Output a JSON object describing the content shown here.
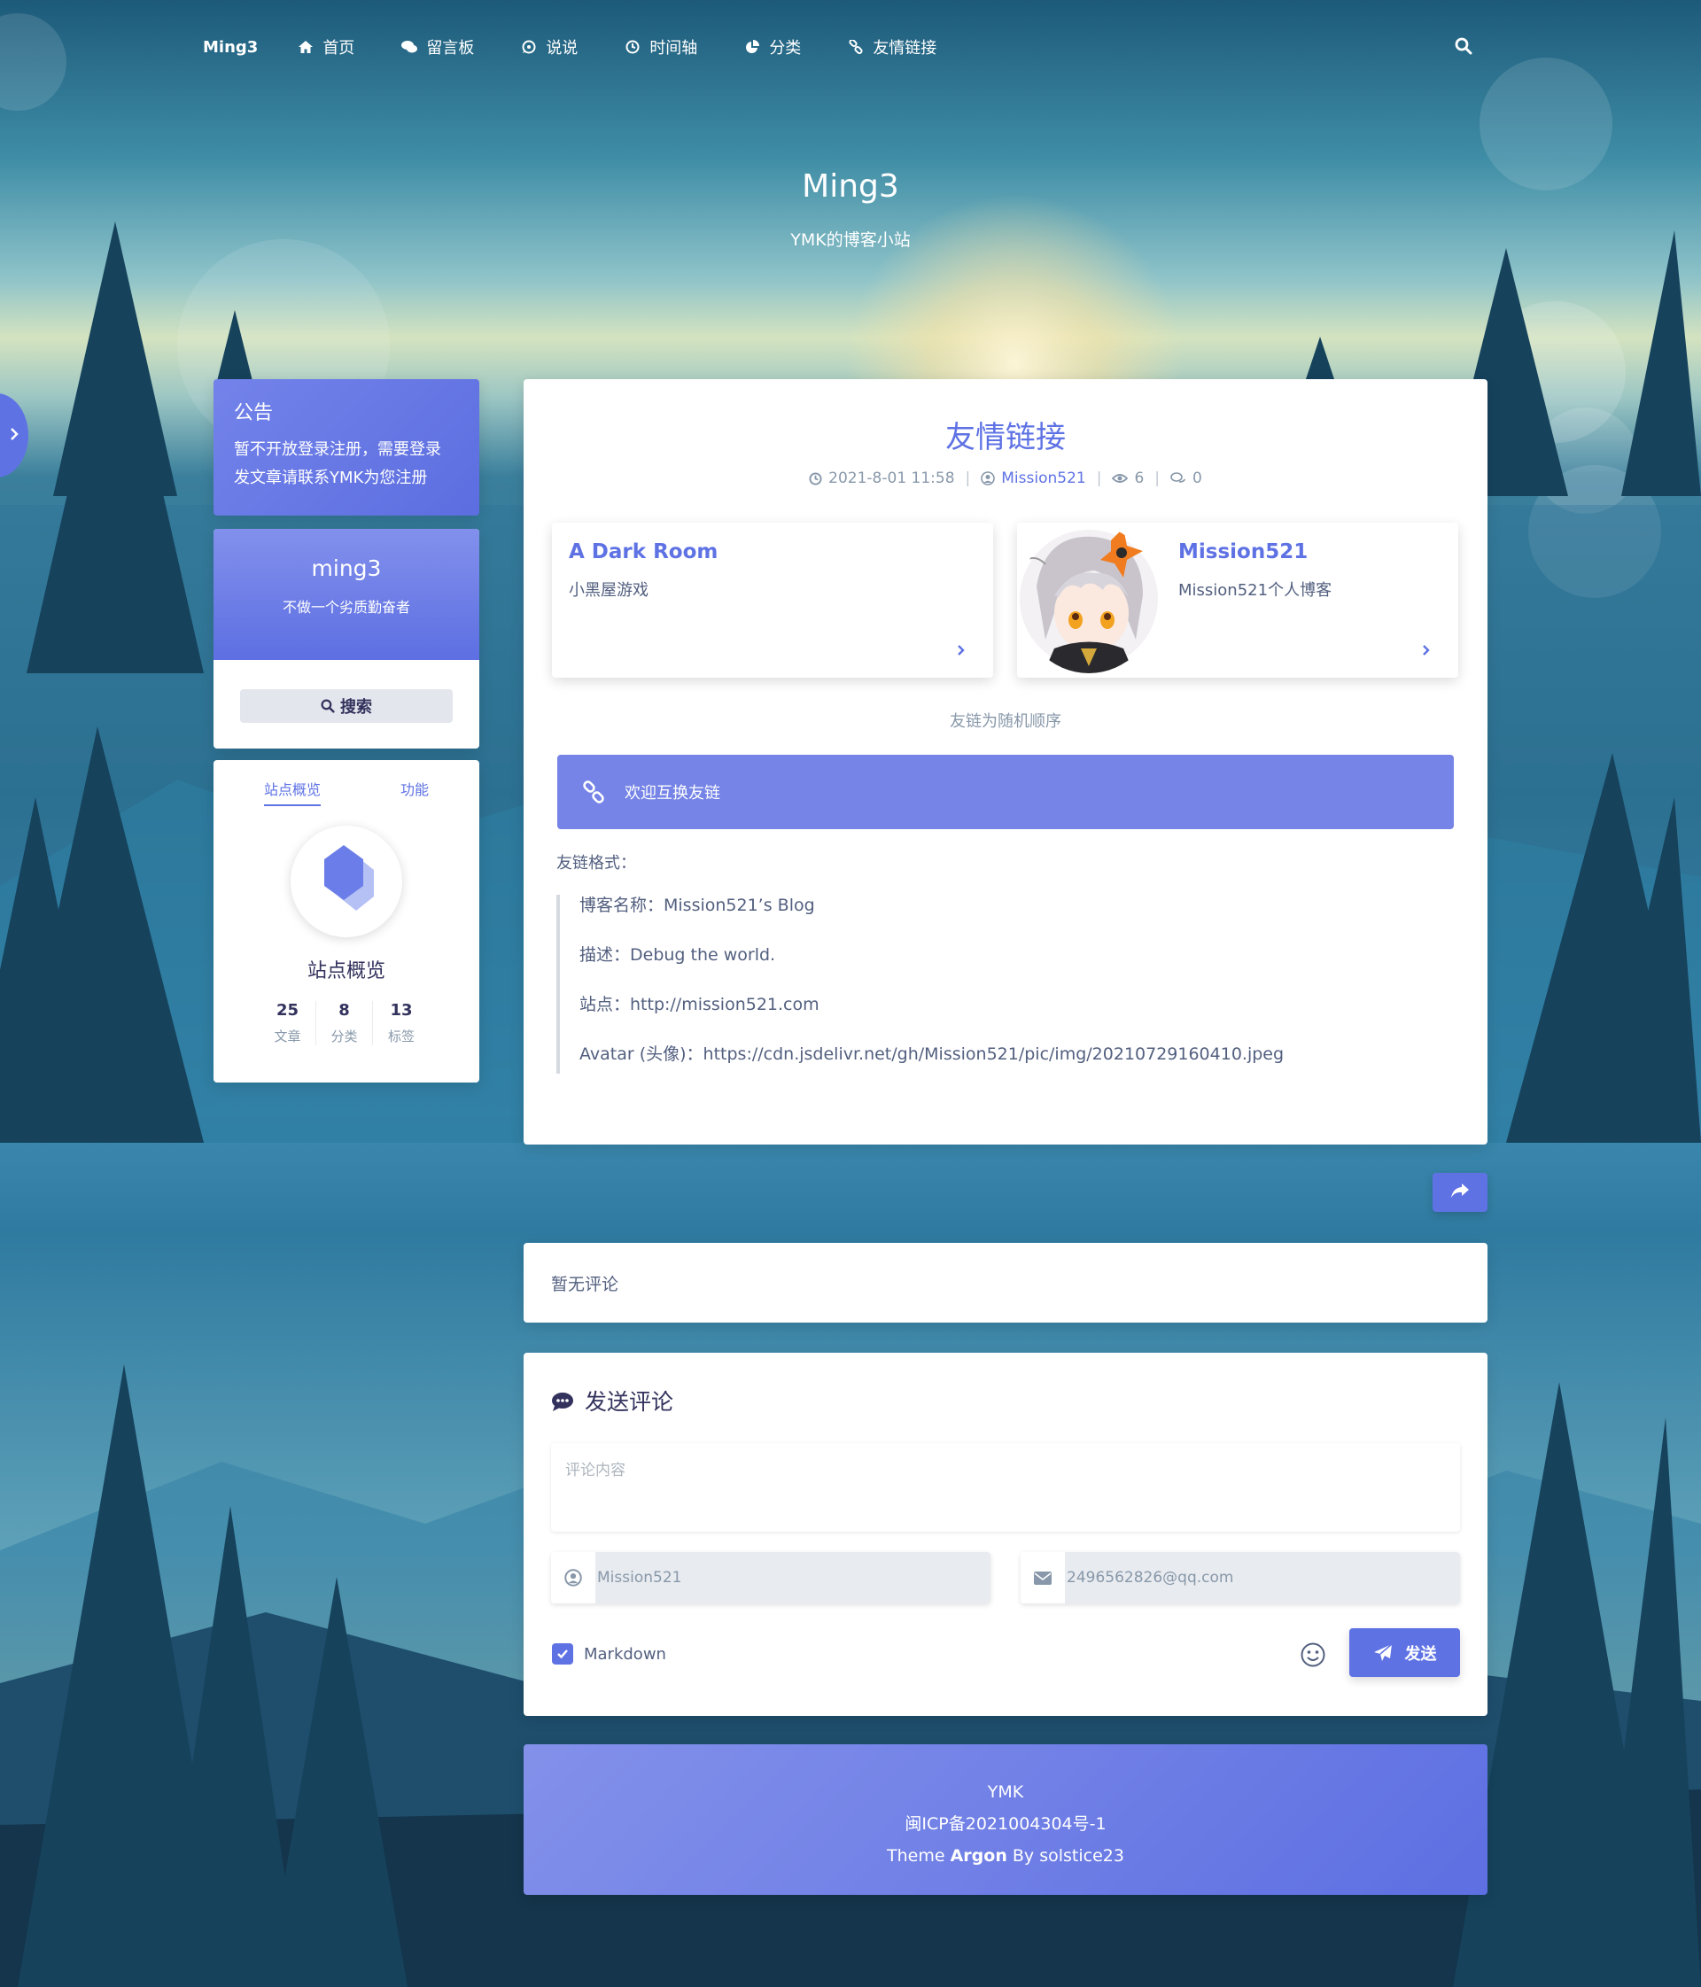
{
  "navbar": {
    "brand": "Ming3",
    "items": [
      {
        "label": "首页",
        "icon": "home-icon"
      },
      {
        "label": "留言板",
        "icon": "comments-icon"
      },
      {
        "label": "说说",
        "icon": "whatsapp-icon"
      },
      {
        "label": "时间轴",
        "icon": "clock-icon"
      },
      {
        "label": "分类",
        "icon": "pie-chart-icon"
      },
      {
        "label": "友情链接",
        "icon": "link-icon"
      }
    ],
    "search_icon": "search-icon"
  },
  "banner": {
    "title": "Ming3",
    "subtitle": "YMK的博客小站"
  },
  "sidebar": {
    "notice": {
      "title": "公告",
      "body_line1": "暂不开放登录注册，需要登录",
      "body_line2": "发文章请联系YMK为您注册"
    },
    "profile": {
      "name": "ming3",
      "motto": "不做一个劣质勤奋者",
      "search_label": "搜索"
    },
    "overview": {
      "tab_overview": "站点概览",
      "tab_function": "功能",
      "title": "站点概览",
      "stats": [
        {
          "num": "25",
          "label": "文章"
        },
        {
          "num": "8",
          "label": "分类"
        },
        {
          "num": "13",
          "label": "标签"
        }
      ]
    }
  },
  "article": {
    "title": "友情链接",
    "meta": {
      "date": "2021-8-01 11:58",
      "author": "Mission521",
      "views": "6",
      "comments": "0"
    },
    "links": [
      {
        "name": "A Dark Room",
        "desc": "小黑屋游戏"
      },
      {
        "name": "Mission521",
        "desc": "Mission521个人博客"
      }
    ],
    "random_note": "友链为随机顺序",
    "alert": "欢迎互换友链",
    "format_label": "友链格式：",
    "format_lines": [
      "博客名称：Mission521’s Blog",
      "描述：Debug the world.",
      "站点：http://mission521.com",
      "Avatar (头像)：https://cdn.jsdelivr.net/gh/Mission521/pic/img/20210729160410.jpeg"
    ]
  },
  "comments": {
    "empty": "暂无评论"
  },
  "comment_form": {
    "title": "发送评论",
    "content_placeholder": "评论内容",
    "name_value": "Mission521",
    "email_value": "2496562826@qq.com",
    "markdown_label": "Markdown",
    "send_label": "发送"
  },
  "footer": {
    "line1": "YMK",
    "line2": "闽ICP备2021004304号-1",
    "line3_prefix": "Theme ",
    "line3_bold": "Argon",
    "line3_suffix": " By solstice23"
  },
  "colors": {
    "accent": "#5e72e4",
    "text": "#525f7f",
    "heading": "#32325d"
  }
}
